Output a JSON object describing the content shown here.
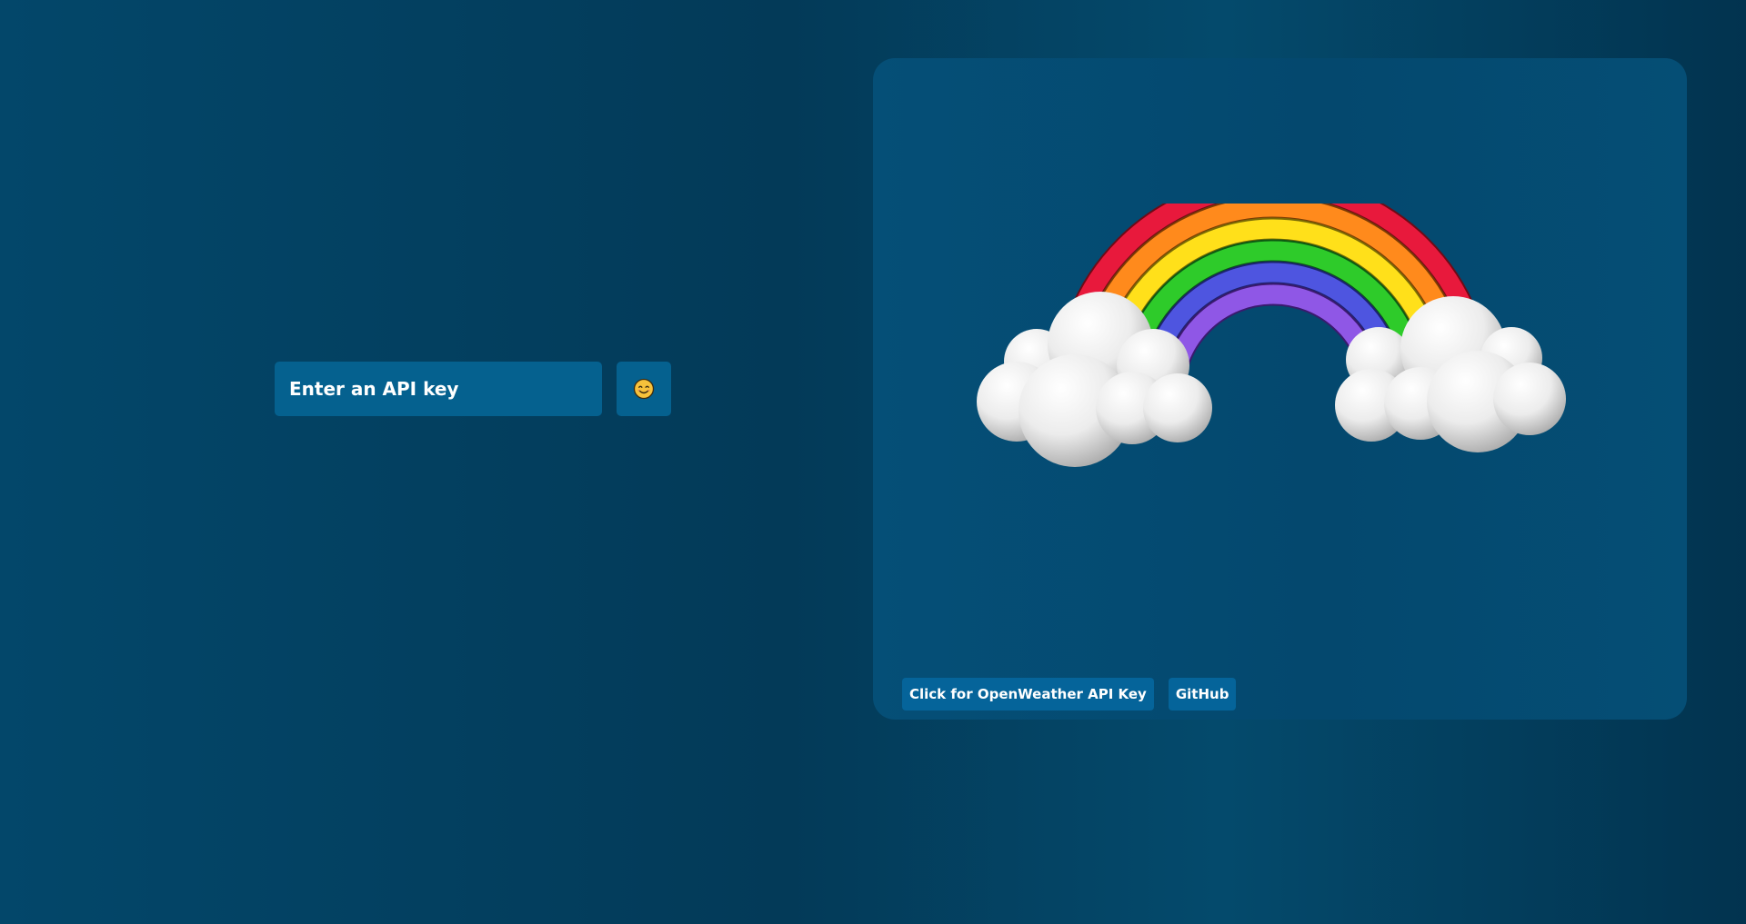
{
  "api_form": {
    "input_placeholder": "Enter an API key",
    "input_value": "",
    "submit_icon": "smiling-face-icon"
  },
  "panel": {
    "hero_icon": "rainbow-with-clouds-icon",
    "links": [
      {
        "label": "Click for OpenWeather API Key"
      },
      {
        "label": "GitHub"
      }
    ]
  },
  "colors": {
    "background": "#033a58",
    "panel": "#04486e",
    "control": "#05618f",
    "text": "#ffffff"
  }
}
